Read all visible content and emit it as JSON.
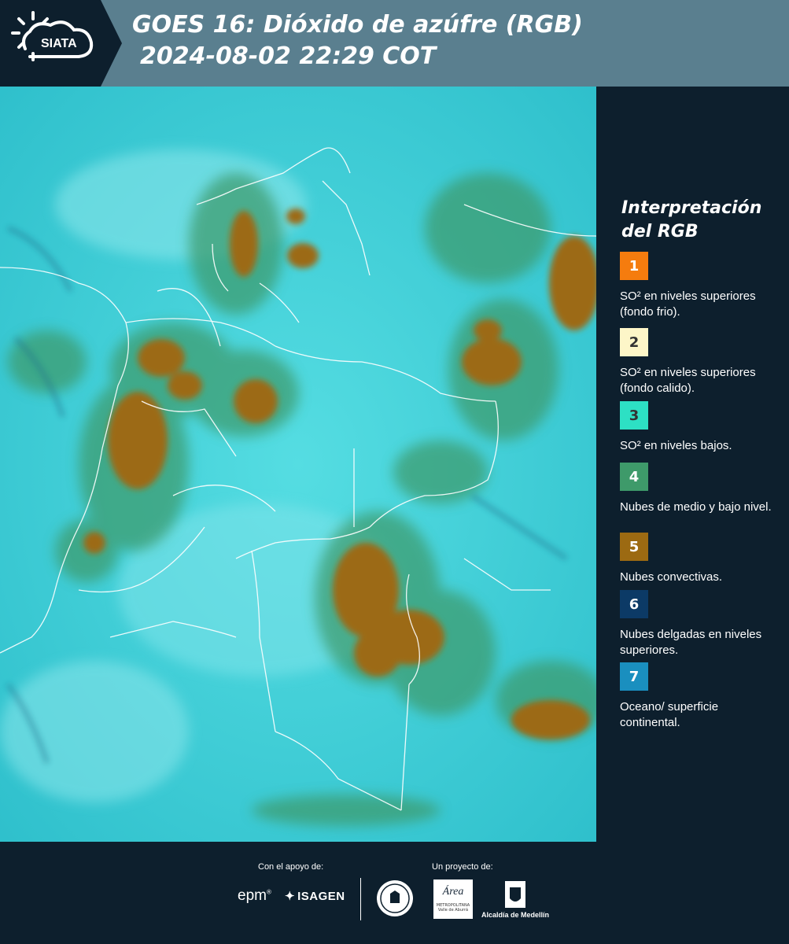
{
  "header": {
    "logo_text": "SIATA",
    "title_line1": "GOES 16: Dióxido de azúfre (RGB)",
    "title_line2": "2024-08-02 22:29 COT"
  },
  "legend": {
    "title": "Interpretación del RGB",
    "items": [
      {
        "number": "1",
        "color": "#f57c0e",
        "text_color": "#ffffff",
        "label": "SO² en niveles superiores (fondo frio)."
      },
      {
        "number": "2",
        "color": "#fdf6c8",
        "text_color": "#333333",
        "label": "SO² en niveles superiores (fondo calido)."
      },
      {
        "number": "3",
        "color": "#2de0c4",
        "text_color": "#333333",
        "label": "SO² en niveles bajos."
      },
      {
        "number": "4",
        "color": "#3e9a6a",
        "text_color": "#ffffff",
        "label": "Nubes de medio y bajo nivel."
      },
      {
        "number": "5",
        "color": "#9c6a12",
        "text_color": "#ffffff",
        "label": "Nubes convectivas."
      },
      {
        "number": "6",
        "color": "#0c3a66",
        "text_color": "#ffffff",
        "label": "Nubes delgadas en niveles superiores."
      },
      {
        "number": "7",
        "color": "#1a8fbf",
        "text_color": "#ffffff",
        "label": "Oceano/ superficie continental."
      }
    ]
  },
  "footer": {
    "support_label": "Con el apoyo de:",
    "project_label": "Un proyecto de:",
    "sponsor_epm": "epm",
    "sponsor_isagen": "ISAGEN",
    "area_logo_text": "Área",
    "area_logo_subtext": "METROPOLITANA Valle de Aburrá",
    "alcaldia_label": "Alcaldía de Medellín"
  },
  "colors": {
    "background": "#0d1f2d",
    "header_band": "#5a7f8f",
    "map_base": "#49d3dc",
    "cloud_convective": "#9c6a12",
    "cloud_mid": "#3e9a6a"
  }
}
